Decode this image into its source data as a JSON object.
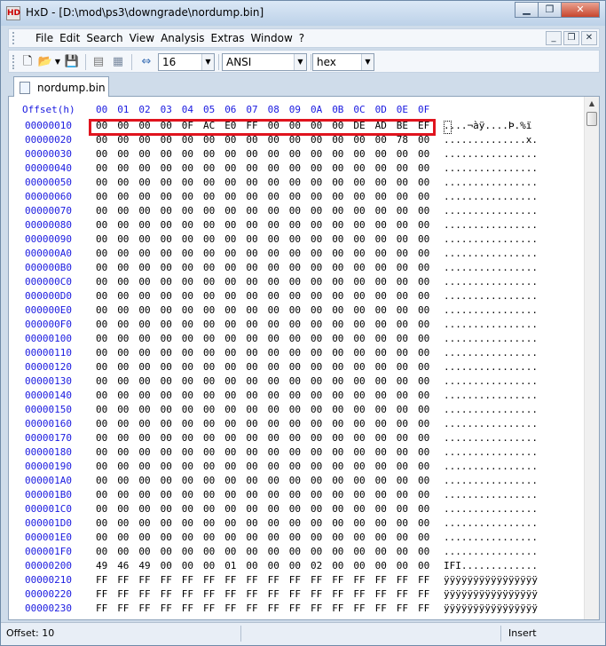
{
  "window": {
    "title": "HxD - [D:\\mod\\ps3\\downgrade\\nordump.bin]",
    "controls": [
      "▁",
      "❐",
      "✕"
    ]
  },
  "menubar": {
    "items": [
      "File",
      "Edit",
      "Search",
      "View",
      "Analysis",
      "Extras",
      "Window",
      "?"
    ]
  },
  "toolbar": {
    "bytes_per_row": "16",
    "charset": "ANSI",
    "offset_base": "hex"
  },
  "tabs": [
    {
      "label": "nordump.bin"
    }
  ],
  "editor": {
    "offset_header": "Offset(h)",
    "columns": [
      "00",
      "01",
      "02",
      "03",
      "04",
      "05",
      "06",
      "07",
      "08",
      "09",
      "0A",
      "0B",
      "0C",
      "0D",
      "0E",
      "0F"
    ],
    "rows": [
      {
        "offset": "00000010",
        "bytes": [
          "00",
          "00",
          "00",
          "00",
          "0F",
          "AC",
          "E0",
          "FF",
          "00",
          "00",
          "00",
          "00",
          "DE",
          "AD",
          "BE",
          "EF"
        ],
        "ascii": "....¬àÿ....Þ.%ï"
      },
      {
        "offset": "00000020",
        "bytes": [
          "00",
          "00",
          "00",
          "00",
          "00",
          "00",
          "00",
          "00",
          "00",
          "00",
          "00",
          "00",
          "00",
          "00",
          "78",
          "00"
        ],
        "ascii": "..............x."
      },
      {
        "offset": "00000030",
        "bytes": [
          "00",
          "00",
          "00",
          "00",
          "00",
          "00",
          "00",
          "00",
          "00",
          "00",
          "00",
          "00",
          "00",
          "00",
          "00",
          "00"
        ],
        "ascii": "................"
      },
      {
        "offset": "00000040",
        "bytes": [
          "00",
          "00",
          "00",
          "00",
          "00",
          "00",
          "00",
          "00",
          "00",
          "00",
          "00",
          "00",
          "00",
          "00",
          "00",
          "00"
        ],
        "ascii": "................"
      },
      {
        "offset": "00000050",
        "bytes": [
          "00",
          "00",
          "00",
          "00",
          "00",
          "00",
          "00",
          "00",
          "00",
          "00",
          "00",
          "00",
          "00",
          "00",
          "00",
          "00"
        ],
        "ascii": "................"
      },
      {
        "offset": "00000060",
        "bytes": [
          "00",
          "00",
          "00",
          "00",
          "00",
          "00",
          "00",
          "00",
          "00",
          "00",
          "00",
          "00",
          "00",
          "00",
          "00",
          "00"
        ],
        "ascii": "................"
      },
      {
        "offset": "00000070",
        "bytes": [
          "00",
          "00",
          "00",
          "00",
          "00",
          "00",
          "00",
          "00",
          "00",
          "00",
          "00",
          "00",
          "00",
          "00",
          "00",
          "00"
        ],
        "ascii": "................"
      },
      {
        "offset": "00000080",
        "bytes": [
          "00",
          "00",
          "00",
          "00",
          "00",
          "00",
          "00",
          "00",
          "00",
          "00",
          "00",
          "00",
          "00",
          "00",
          "00",
          "00"
        ],
        "ascii": "................"
      },
      {
        "offset": "00000090",
        "bytes": [
          "00",
          "00",
          "00",
          "00",
          "00",
          "00",
          "00",
          "00",
          "00",
          "00",
          "00",
          "00",
          "00",
          "00",
          "00",
          "00"
        ],
        "ascii": "................"
      },
      {
        "offset": "000000A0",
        "bytes": [
          "00",
          "00",
          "00",
          "00",
          "00",
          "00",
          "00",
          "00",
          "00",
          "00",
          "00",
          "00",
          "00",
          "00",
          "00",
          "00"
        ],
        "ascii": "................"
      },
      {
        "offset": "000000B0",
        "bytes": [
          "00",
          "00",
          "00",
          "00",
          "00",
          "00",
          "00",
          "00",
          "00",
          "00",
          "00",
          "00",
          "00",
          "00",
          "00",
          "00"
        ],
        "ascii": "................"
      },
      {
        "offset": "000000C0",
        "bytes": [
          "00",
          "00",
          "00",
          "00",
          "00",
          "00",
          "00",
          "00",
          "00",
          "00",
          "00",
          "00",
          "00",
          "00",
          "00",
          "00"
        ],
        "ascii": "................"
      },
      {
        "offset": "000000D0",
        "bytes": [
          "00",
          "00",
          "00",
          "00",
          "00",
          "00",
          "00",
          "00",
          "00",
          "00",
          "00",
          "00",
          "00",
          "00",
          "00",
          "00"
        ],
        "ascii": "................"
      },
      {
        "offset": "000000E0",
        "bytes": [
          "00",
          "00",
          "00",
          "00",
          "00",
          "00",
          "00",
          "00",
          "00",
          "00",
          "00",
          "00",
          "00",
          "00",
          "00",
          "00"
        ],
        "ascii": "................"
      },
      {
        "offset": "000000F0",
        "bytes": [
          "00",
          "00",
          "00",
          "00",
          "00",
          "00",
          "00",
          "00",
          "00",
          "00",
          "00",
          "00",
          "00",
          "00",
          "00",
          "00"
        ],
        "ascii": "................"
      },
      {
        "offset": "00000100",
        "bytes": [
          "00",
          "00",
          "00",
          "00",
          "00",
          "00",
          "00",
          "00",
          "00",
          "00",
          "00",
          "00",
          "00",
          "00",
          "00",
          "00"
        ],
        "ascii": "................"
      },
      {
        "offset": "00000110",
        "bytes": [
          "00",
          "00",
          "00",
          "00",
          "00",
          "00",
          "00",
          "00",
          "00",
          "00",
          "00",
          "00",
          "00",
          "00",
          "00",
          "00"
        ],
        "ascii": "................"
      },
      {
        "offset": "00000120",
        "bytes": [
          "00",
          "00",
          "00",
          "00",
          "00",
          "00",
          "00",
          "00",
          "00",
          "00",
          "00",
          "00",
          "00",
          "00",
          "00",
          "00"
        ],
        "ascii": "................"
      },
      {
        "offset": "00000130",
        "bytes": [
          "00",
          "00",
          "00",
          "00",
          "00",
          "00",
          "00",
          "00",
          "00",
          "00",
          "00",
          "00",
          "00",
          "00",
          "00",
          "00"
        ],
        "ascii": "................"
      },
      {
        "offset": "00000140",
        "bytes": [
          "00",
          "00",
          "00",
          "00",
          "00",
          "00",
          "00",
          "00",
          "00",
          "00",
          "00",
          "00",
          "00",
          "00",
          "00",
          "00"
        ],
        "ascii": "................"
      },
      {
        "offset": "00000150",
        "bytes": [
          "00",
          "00",
          "00",
          "00",
          "00",
          "00",
          "00",
          "00",
          "00",
          "00",
          "00",
          "00",
          "00",
          "00",
          "00",
          "00"
        ],
        "ascii": "................"
      },
      {
        "offset": "00000160",
        "bytes": [
          "00",
          "00",
          "00",
          "00",
          "00",
          "00",
          "00",
          "00",
          "00",
          "00",
          "00",
          "00",
          "00",
          "00",
          "00",
          "00"
        ],
        "ascii": "................"
      },
      {
        "offset": "00000170",
        "bytes": [
          "00",
          "00",
          "00",
          "00",
          "00",
          "00",
          "00",
          "00",
          "00",
          "00",
          "00",
          "00",
          "00",
          "00",
          "00",
          "00"
        ],
        "ascii": "................"
      },
      {
        "offset": "00000180",
        "bytes": [
          "00",
          "00",
          "00",
          "00",
          "00",
          "00",
          "00",
          "00",
          "00",
          "00",
          "00",
          "00",
          "00",
          "00",
          "00",
          "00"
        ],
        "ascii": "................"
      },
      {
        "offset": "00000190",
        "bytes": [
          "00",
          "00",
          "00",
          "00",
          "00",
          "00",
          "00",
          "00",
          "00",
          "00",
          "00",
          "00",
          "00",
          "00",
          "00",
          "00"
        ],
        "ascii": "................"
      },
      {
        "offset": "000001A0",
        "bytes": [
          "00",
          "00",
          "00",
          "00",
          "00",
          "00",
          "00",
          "00",
          "00",
          "00",
          "00",
          "00",
          "00",
          "00",
          "00",
          "00"
        ],
        "ascii": "................"
      },
      {
        "offset": "000001B0",
        "bytes": [
          "00",
          "00",
          "00",
          "00",
          "00",
          "00",
          "00",
          "00",
          "00",
          "00",
          "00",
          "00",
          "00",
          "00",
          "00",
          "00"
        ],
        "ascii": "................"
      },
      {
        "offset": "000001C0",
        "bytes": [
          "00",
          "00",
          "00",
          "00",
          "00",
          "00",
          "00",
          "00",
          "00",
          "00",
          "00",
          "00",
          "00",
          "00",
          "00",
          "00"
        ],
        "ascii": "................"
      },
      {
        "offset": "000001D0",
        "bytes": [
          "00",
          "00",
          "00",
          "00",
          "00",
          "00",
          "00",
          "00",
          "00",
          "00",
          "00",
          "00",
          "00",
          "00",
          "00",
          "00"
        ],
        "ascii": "................"
      },
      {
        "offset": "000001E0",
        "bytes": [
          "00",
          "00",
          "00",
          "00",
          "00",
          "00",
          "00",
          "00",
          "00",
          "00",
          "00",
          "00",
          "00",
          "00",
          "00",
          "00"
        ],
        "ascii": "................"
      },
      {
        "offset": "000001F0",
        "bytes": [
          "00",
          "00",
          "00",
          "00",
          "00",
          "00",
          "00",
          "00",
          "00",
          "00",
          "00",
          "00",
          "00",
          "00",
          "00",
          "00"
        ],
        "ascii": "................"
      },
      {
        "offset": "00000200",
        "bytes": [
          "49",
          "46",
          "49",
          "00",
          "00",
          "00",
          "01",
          "00",
          "00",
          "00",
          "02",
          "00",
          "00",
          "00",
          "00",
          "00"
        ],
        "ascii": "IFI............."
      },
      {
        "offset": "00000210",
        "bytes": [
          "FF",
          "FF",
          "FF",
          "FF",
          "FF",
          "FF",
          "FF",
          "FF",
          "FF",
          "FF",
          "FF",
          "FF",
          "FF",
          "FF",
          "FF",
          "FF"
        ],
        "ascii": "ÿÿÿÿÿÿÿÿÿÿÿÿÿÿÿÿ"
      },
      {
        "offset": "00000220",
        "bytes": [
          "FF",
          "FF",
          "FF",
          "FF",
          "FF",
          "FF",
          "FF",
          "FF",
          "FF",
          "FF",
          "FF",
          "FF",
          "FF",
          "FF",
          "FF",
          "FF"
        ],
        "ascii": "ÿÿÿÿÿÿÿÿÿÿÿÿÿÿÿÿ"
      },
      {
        "offset": "00000230",
        "bytes": [
          "FF",
          "FF",
          "FF",
          "FF",
          "FF",
          "FF",
          "FF",
          "FF",
          "FF",
          "FF",
          "FF",
          "FF",
          "FF",
          "FF",
          "FF",
          "FF"
        ],
        "ascii": "ÿÿÿÿÿÿÿÿÿÿÿÿÿÿÿÿ"
      }
    ]
  },
  "statusbar": {
    "offset": "Offset: 10",
    "mode": "Insert"
  },
  "colors": {
    "offset_blue": "#1a1ae0",
    "highlight_red": "#e0141e"
  }
}
